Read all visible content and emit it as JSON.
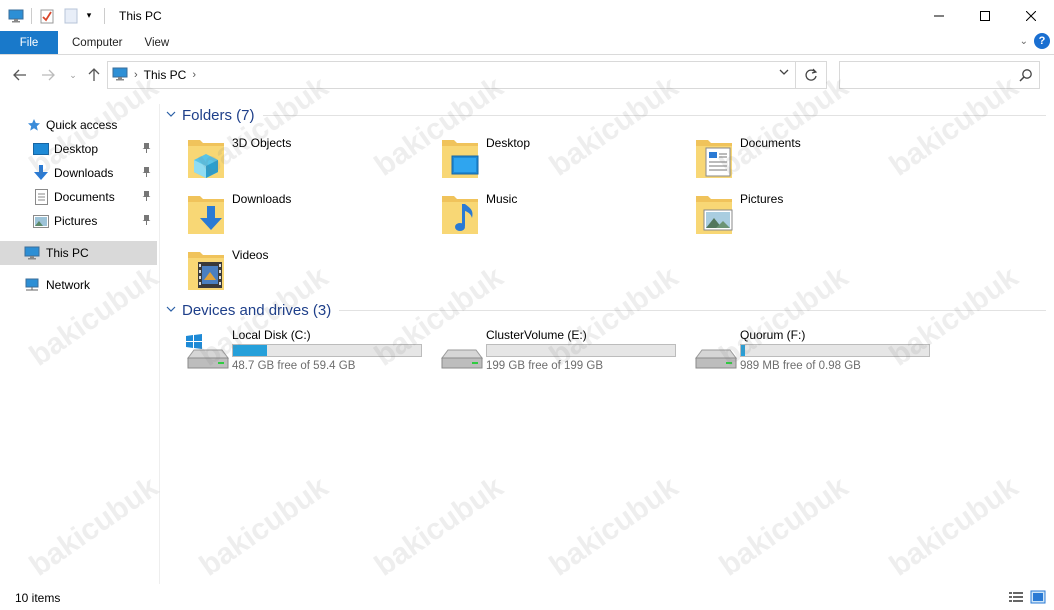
{
  "window": {
    "title": "This PC",
    "controls": [
      "minimize",
      "maximize",
      "close"
    ]
  },
  "ribbon": {
    "tabs": [
      "File",
      "Computer",
      "View"
    ]
  },
  "address": {
    "segments": [
      "This PC"
    ],
    "search_placeholder": ""
  },
  "sidebar": {
    "items": [
      {
        "label": "Quick access",
        "icon": "star-icon"
      },
      {
        "label": "Desktop",
        "icon": "desktop-icon",
        "pinned": true
      },
      {
        "label": "Downloads",
        "icon": "download-icon",
        "pinned": true
      },
      {
        "label": "Documents",
        "icon": "document-icon",
        "pinned": true
      },
      {
        "label": "Pictures",
        "icon": "pictures-icon",
        "pinned": true
      },
      {
        "label": "This PC",
        "icon": "computer-icon",
        "selected": true
      },
      {
        "label": "Network",
        "icon": "network-icon"
      }
    ]
  },
  "groups": {
    "folders_title": "Folders (7)",
    "drives_title": "Devices and drives (3)"
  },
  "folders": [
    {
      "label": "3D Objects",
      "icon": "3d-objects-folder-icon"
    },
    {
      "label": "Desktop",
      "icon": "desktop-folder-icon"
    },
    {
      "label": "Documents",
      "icon": "documents-folder-icon"
    },
    {
      "label": "Downloads",
      "icon": "downloads-folder-icon"
    },
    {
      "label": "Music",
      "icon": "music-folder-icon"
    },
    {
      "label": "Pictures",
      "icon": "pictures-folder-icon"
    },
    {
      "label": "Videos",
      "icon": "videos-folder-icon"
    }
  ],
  "drives": [
    {
      "label": "Local Disk (C:)",
      "free": "48.7 GB free of 59.4 GB",
      "used_fraction": 0.18,
      "icon": "windows-drive-icon"
    },
    {
      "label": "ClusterVolume (E:)",
      "free": "199 GB free of 199 GB",
      "used_fraction": 0.0,
      "icon": "hard-drive-icon"
    },
    {
      "label": "Quorum (F:)",
      "free": "989 MB free of 0.98 GB",
      "used_fraction": 0.02,
      "icon": "hard-drive-icon"
    }
  ],
  "status": {
    "item_count": "10 items"
  },
  "watermark": "bakicubuk",
  "colors": {
    "accent": "#1979ca",
    "drive_bar": "#26a0da",
    "group_title": "#1e3f8a",
    "folder_yellow": "#f7c948"
  }
}
